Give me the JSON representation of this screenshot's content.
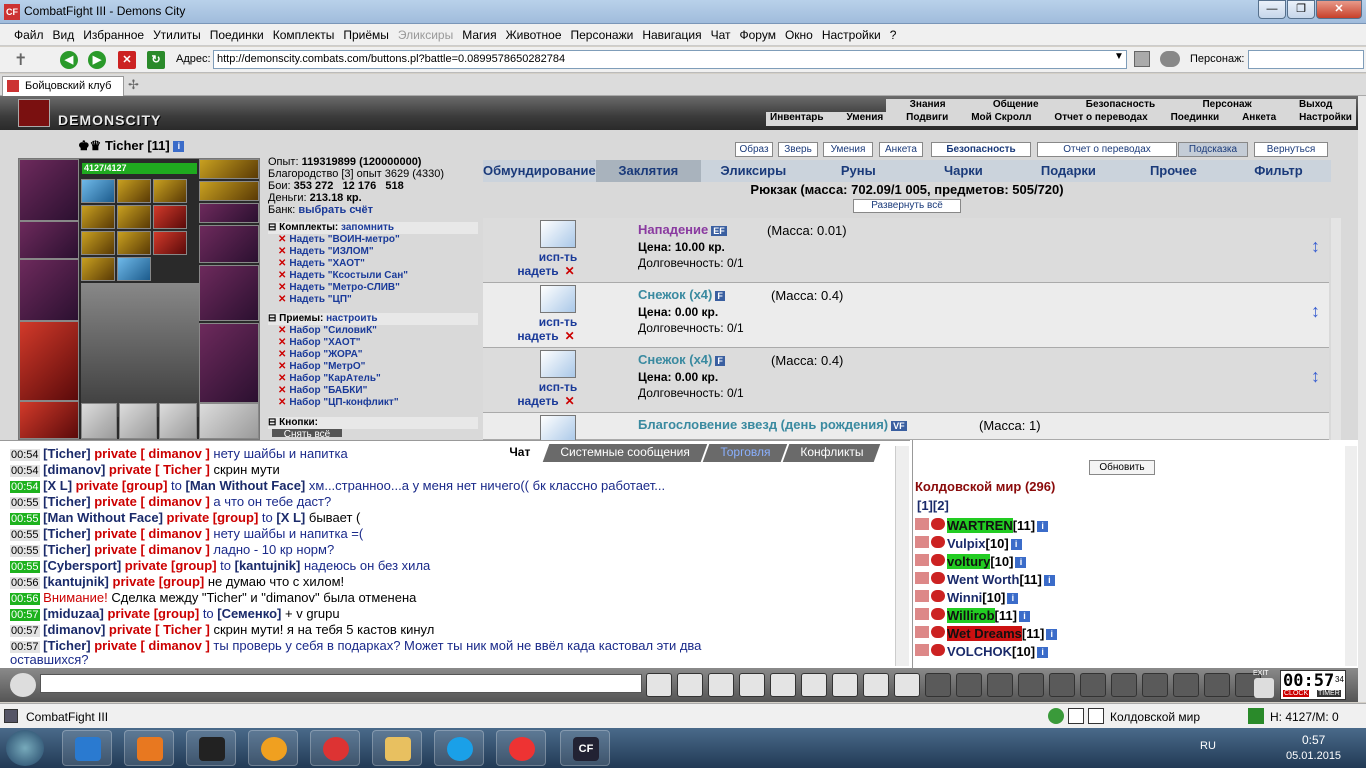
{
  "window": {
    "title": "CombatFight III - Demons City",
    "min": "—",
    "max": "❐",
    "close": "✕"
  },
  "menu": [
    "Файл",
    "Вид",
    "Избранное",
    "Утилиты",
    "Поединки",
    "Комплекты",
    "Приёмы",
    "Эликсиры",
    "Магия",
    "Животное",
    "Персонажи",
    "Навигация",
    "Чат",
    "Форум",
    "Окно",
    "Настройки",
    "?"
  ],
  "address": {
    "label": "Адрес:",
    "url": "http://demonscity.combats.com/buttons.pl?battle=0.0899578650282784",
    "char_label": "Персонаж:"
  },
  "tab": {
    "label": "Бойцовский клуб"
  },
  "nav1": [
    "Знания",
    "Общение",
    "Безопасность",
    "Персонаж",
    "Выход"
  ],
  "nav2": [
    "Инвентарь",
    "Умения",
    "Подвиги",
    "Мой Скролл",
    "Отчет о переводах",
    "Поединки",
    "Анкета",
    "Настройки"
  ],
  "logo": "DEMONSCITY",
  "char": {
    "name": "Ticher [11]",
    "hp": "4127/4127"
  },
  "stats": {
    "exp_label": "Опыт:",
    "exp": "119319899 (120000000)",
    "blag_label": "Благородство",
    "blag": "[3] опыт 3629 (4330)",
    "boi_label": "Бои:",
    "boi": "353 272",
    "boi2": "12 176",
    "boi3": "518",
    "money_label": "Деньги:",
    "money": "213.18 кр.",
    "bank_label": "Банк:",
    "bank": "выбрать счёт"
  },
  "komplekty": {
    "title": "Комплекты:",
    "remember": "запомнить",
    "items": [
      "Надеть \"ВОИН-метро\"",
      "Надеть \"ИЗЛОМ\"",
      "Надеть \"ХАОТ\"",
      "Надеть \"Ксостыли Сан\"",
      "Надеть \"Метро-СЛИВ\"",
      "Надеть \"ЦП\""
    ]
  },
  "priemy": {
    "title": "Приемы:",
    "setup": "настроить",
    "items": [
      "Набор \"СиловиК\"",
      "Набор \"ХАОТ\"",
      "Набор \"ЖОРА\"",
      "Набор \"МетрО\"",
      "Набор \"КарАтель\"",
      "Набор \"БАБКИ\"",
      "Набор \"ЦП-конфликт\""
    ]
  },
  "knopki": {
    "title": "Кнопки:",
    "btn": "Снять всё"
  },
  "topbtns": [
    "Образ",
    "Зверь",
    "Умения",
    "Анкета",
    "Безопасность",
    "Отчет о переводах",
    "Подсказка",
    "Вернуться"
  ],
  "cats": [
    "Обмундирование",
    "Заклятия",
    "Эликсиры",
    "Руны",
    "Чарки",
    "Подарки",
    "Прочее",
    "Фильтр"
  ],
  "backpack": {
    "title": "Рюкзак (масса: 702.09/1 005, предметов: 505/720)",
    "expand": "Развернуть всё"
  },
  "items": [
    {
      "use": "исп-ть",
      "wear": "надеть",
      "name": "Нападение",
      "badge": "EF",
      "mass": "(Масса: 0.01)",
      "price": "Цена: 10.00 кр.",
      "dur": "Долговечность: 0/1"
    },
    {
      "use": "исп-ть",
      "wear": "надеть",
      "name": "Снежок (x4)",
      "badge": "F",
      "mass": "(Масса: 0.4)",
      "price": "Цена: 0.00 кр.",
      "dur": "Долговечность: 0/1"
    },
    {
      "use": "исп-ть",
      "wear": "надеть",
      "name": "Снежок (x4)",
      "badge": "F",
      "mass": "(Масса: 0.4)",
      "price": "Цена: 0.00 кр.",
      "dur": "Долговечность: 0/1"
    },
    {
      "name": "Благословение звезд (день рождения)",
      "badge": "VF",
      "mass": "(Масса: 1)"
    }
  ],
  "chattabs": [
    "Чат",
    "Системные сообщения",
    "Торговля",
    "Конфликты"
  ],
  "chat": [
    {
      "t": "00:54",
      "g": false,
      "n": "[Ticher]",
      "p": "private [ dimanov ]",
      "m": "нету шайбы и напитка",
      "c": "msg"
    },
    {
      "t": "00:54",
      "g": false,
      "n": "[dimanov]",
      "p": "private [ Ticher ]",
      "m": "скрин мути",
      "c": "msg blk"
    },
    {
      "t": "00:54",
      "g": true,
      "n": "[X L]",
      "p": "private [group]",
      "to": "to",
      "n2": "[Man Without Face]",
      "m": "хм...странноо...а у меня нет ничего(( бк классно работает...",
      "c": "msg"
    },
    {
      "t": "00:55",
      "g": false,
      "n": "[Ticher]",
      "p": "private [ dimanov ]",
      "m": "а что он тебе даст?",
      "c": "msg"
    },
    {
      "t": "00:55",
      "g": true,
      "n": "[Man Without Face]",
      "p": "private [group]",
      "to": "to",
      "n2": "[X L]",
      "m": "бывает (",
      "c": "msg blk"
    },
    {
      "t": "00:55",
      "g": false,
      "n": "[Ticher]",
      "p": "private [ dimanov ]",
      "m": "нету шайбы и напитка =(",
      "c": "msg"
    },
    {
      "t": "00:55",
      "g": false,
      "n": "[Ticher]",
      "p": "private [ dimanov ]",
      "m": "ладно - 10 кр норм?",
      "c": "msg"
    },
    {
      "t": "00:55",
      "g": true,
      "n": "[Cybersport]",
      "p": "private [group]",
      "to": "to",
      "n2": "[kantujnik]",
      "m": "надеюсь он без хила",
      "c": "msg"
    },
    {
      "t": "00:56",
      "g": false,
      "n": "[kantujnik]",
      "p": "private [group]",
      "m": "не думаю что с хилом!",
      "c": "msg blk"
    },
    {
      "t": "00:56",
      "g": true,
      "warn": "Внимание!",
      "m": "Сделка между \"Ticher\" и \"dimanov\" была отменена",
      "c": "msg blk"
    },
    {
      "t": "00:57",
      "g": true,
      "n": "[miduzaa]",
      "p": "private [group]",
      "to": "to",
      "n2": "[Семенко]",
      "m": "+ v grupu",
      "c": "msg blk"
    },
    {
      "t": "00:57",
      "g": false,
      "n": "[dimanov]",
      "p": "private [ Ticher ]",
      "m": "скрин мути! я на тебя 5 кастов кинул",
      "c": "msg blk"
    },
    {
      "t": "00:57",
      "g": false,
      "n": "[Ticher]",
      "p": "private [ dimanov ]",
      "m": "ты проверь у себя в подарках? Может ты ник мой не ввёл када кастовал эти два",
      "c": "msg"
    }
  ],
  "chat_wrap": "оставшихся?",
  "right": {
    "refresh": "Обновить",
    "world": "Колдовской мир (296)",
    "pages": "[1][2]",
    "players": [
      {
        "n": "WARTREN",
        "l": "[11]",
        "bg": "#22cc22"
      },
      {
        "n": "Vulpix",
        "l": "[10]",
        "bg": ""
      },
      {
        "n": "voltury",
        "l": "[10]",
        "bg": "#22cc22"
      },
      {
        "n": "Went Worth",
        "l": "[11]",
        "bg": ""
      },
      {
        "n": "Winni",
        "l": "[10]",
        "bg": ""
      },
      {
        "n": "Willirob",
        "l": "[11]",
        "bg": "#22cc22"
      },
      {
        "n": "Wet Dreams",
        "l": "[11]",
        "bg": "#cc1111"
      },
      {
        "n": "VOLCHOK",
        "l": "[10]",
        "bg": ""
      }
    ]
  },
  "clock": {
    "time": "00:57",
    "sec": "34",
    "clock": "CLOCK",
    "timer": "TIMER",
    "exit": "EXIT"
  },
  "statusbar": {
    "app": "CombatFight III",
    "world": "Колдовской мир",
    "hm": "H: 4127/M: 0"
  },
  "taskbar": {
    "lang": "RU",
    "time": "0:57",
    "date": "05.01.2015"
  }
}
